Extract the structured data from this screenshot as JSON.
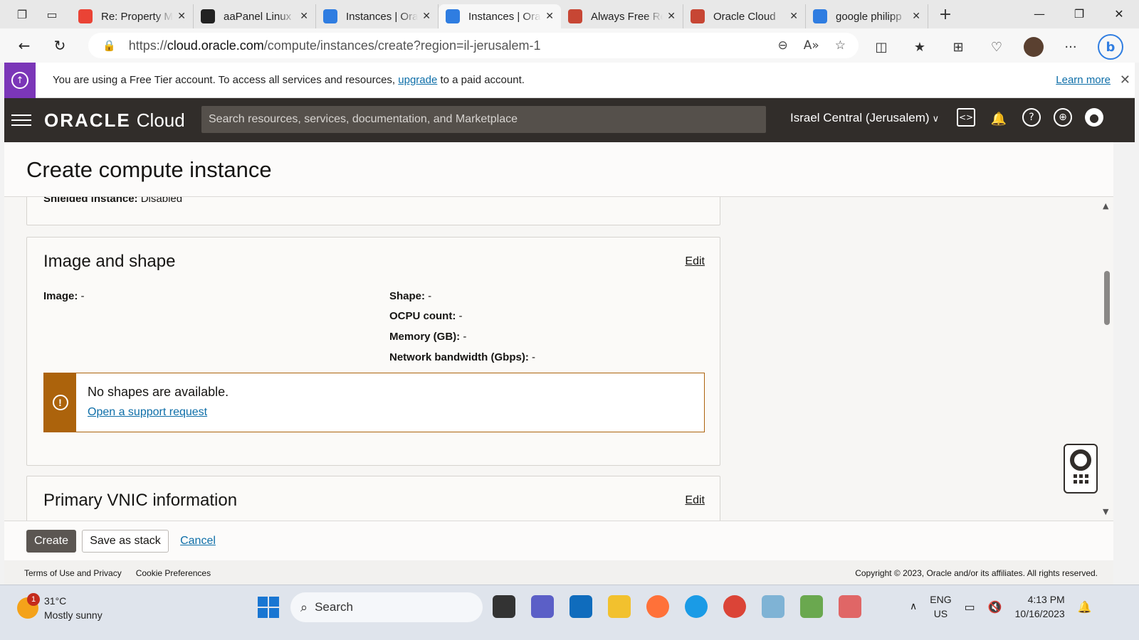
{
  "browser": {
    "tabs": [
      {
        "title": "Re: Property M",
        "favicon": "gmail-icon",
        "color": "#ea4335"
      },
      {
        "title": "aaPanel Linux",
        "favicon": "bt-icon",
        "color": "#222222"
      },
      {
        "title": "Instances | Ora",
        "favicon": "oracle-cloud-icon",
        "color": "#2f7de1"
      },
      {
        "title": "Instances | Ora",
        "favicon": "oracle-cloud-icon",
        "color": "#2f7de1",
        "active": true
      },
      {
        "title": "Always Free Re",
        "favicon": "oracle-icon",
        "color": "#c74634"
      },
      {
        "title": "Oracle Cloud",
        "favicon": "oracle-icon",
        "color": "#c74634"
      },
      {
        "title": "google philipp",
        "favicon": "search-icon",
        "color": "#2f7de1"
      }
    ],
    "url_prefix": "https://",
    "url_host": "cloud.oracle.com",
    "url_path": "/compute/instances/create?region=il-jerusalem-1"
  },
  "banner": {
    "text_before": "You are using a Free Tier account. To access all services and resources, ",
    "upgrade_link": "upgrade",
    "text_after": " to a paid account.",
    "learn_more": "Learn more",
    "accent": "#7b36b8"
  },
  "header": {
    "brand_oracle": "ORACLE",
    "brand_cloud": "Cloud",
    "search_placeholder": "Search resources, services, documentation, and Marketplace",
    "region": "Israel Central (Jerusalem)"
  },
  "page": {
    "title": "Create compute instance",
    "prev_card": {
      "label": "Shielded instance:",
      "value": " Disabled"
    },
    "image_card": {
      "heading": "Image and shape",
      "edit": "Edit",
      "image_label": "Image:",
      "image_value": " -",
      "shape_label": "Shape:",
      "shape_value": " -",
      "ocpu_label": "OCPU count:",
      "ocpu_value": " -",
      "memory_label": "Memory (GB):",
      "memory_value": " -",
      "bandwidth_label": "Network bandwidth (Gbps):",
      "bandwidth_value": " -"
    },
    "alert": {
      "title": "No shapes are available.",
      "link": "Open a support request",
      "color": "#ac630c"
    },
    "vnic_card": {
      "heading": "Primary VNIC information",
      "edit": "Edit"
    }
  },
  "actions": {
    "create": "Create",
    "save_stack": "Save as stack",
    "cancel": "Cancel"
  },
  "footer": {
    "terms": "Terms of Use and Privacy",
    "cookies": "Cookie Preferences",
    "copyright": "Copyright © 2023, Oracle and/or its affiliates. All rights reserved."
  },
  "taskbar": {
    "weather_temp": "31°C",
    "weather_desc": "Mostly sunny",
    "weather_badge": "1",
    "search": "Search",
    "lang_1": "ENG",
    "lang_2": "US",
    "time": "4:13 PM",
    "date": "10/16/2023"
  }
}
